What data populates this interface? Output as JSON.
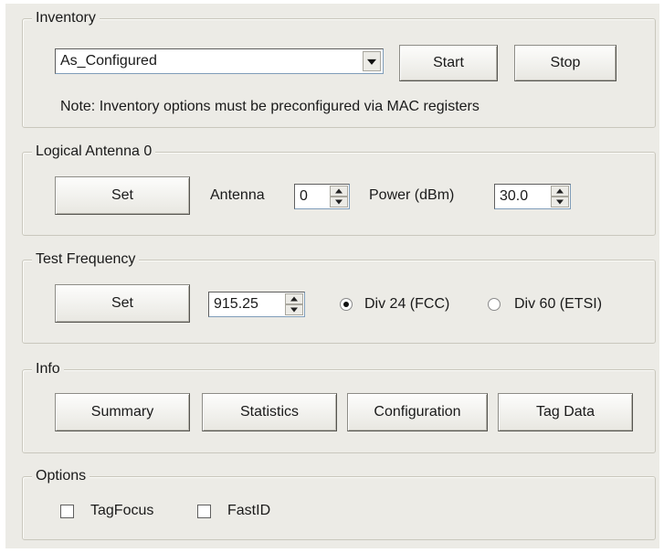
{
  "inventory": {
    "legend": "Inventory",
    "selected_option": "As_Configured",
    "start_label": "Start",
    "stop_label": "Stop",
    "note": "Note: Inventory options must be preconfigured via MAC registers"
  },
  "logical_antenna": {
    "legend": "Logical Antenna 0",
    "set_label": "Set",
    "antenna_label": "Antenna",
    "antenna_value": "0",
    "power_label": "Power (dBm)",
    "power_value": "30.0"
  },
  "test_frequency": {
    "legend": "Test Frequency",
    "set_label": "Set",
    "frequency_value": "915.25",
    "radio_fcc_label": "Div 24 (FCC)",
    "radio_etsi_label": "Div 60 (ETSI)",
    "selected": "fcc"
  },
  "info": {
    "legend": "Info",
    "summary_label": "Summary",
    "statistics_label": "Statistics",
    "configuration_label": "Configuration",
    "tagdata_label": "Tag Data"
  },
  "options": {
    "legend": "Options",
    "tagfocus_label": "TagFocus",
    "tagfocus_checked": false,
    "fastid_label": "FastID",
    "fastid_checked": false
  }
}
